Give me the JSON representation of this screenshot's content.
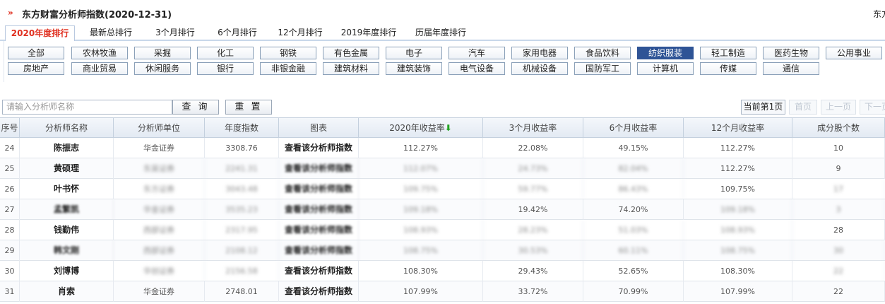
{
  "header": {
    "arrow": "»",
    "title": "东方财富分析师指数(2020-12-31)",
    "right_text": "东方"
  },
  "tabs": [
    {
      "label": "2020年度排行",
      "active": true
    },
    {
      "label": "最新总排行"
    },
    {
      "label": "3个月排行"
    },
    {
      "label": "6个月排行"
    },
    {
      "label": "12个月排行"
    },
    {
      "label": "2019年度排行"
    },
    {
      "label": "历届年度排行"
    }
  ],
  "categories_row1": [
    "全部",
    "农林牧渔",
    "采掘",
    "化工",
    "钢铁",
    "有色金属",
    "电子",
    "汽车",
    "家用电器",
    "食品饮料",
    "纺织服装",
    "轻工制造",
    "医药生物",
    "公用事业"
  ],
  "categories_row2": [
    "房地产",
    "商业贸易",
    "休闲服务",
    "银行",
    "非银金融",
    "建筑材料",
    "建筑装饰",
    "电气设备",
    "机械设备",
    "国防军工",
    "计算机",
    "传媒",
    "通信"
  ],
  "active_category": "纺织服装",
  "search": {
    "placeholder": "请输入分析师名称",
    "query_label": "查 询",
    "reset_label": "重 置"
  },
  "pager": {
    "current": "当前第1页",
    "first": "首页",
    "prev": "上一页",
    "next": "下一页"
  },
  "table": {
    "headers": [
      "序号",
      "分析师名称",
      "分析师单位",
      "年度指数",
      "图表",
      "2020年收益率",
      "3个月收益率",
      "6个月收益率",
      "12个月收益率",
      "成分股个数"
    ],
    "sort_indicator": "⬇",
    "rows": [
      [
        "24",
        "陈振志",
        "华金证券",
        "3308.76",
        "查看该分析师指数",
        "112.27%",
        "22.08%",
        "49.15%",
        "112.27%",
        "10"
      ],
      [
        "25",
        "黄硕理",
        "东吴证券",
        "2241.31",
        "查看该分析师指数",
        "112.07%",
        "24.73%",
        "82.04%",
        "112.27%",
        "9"
      ],
      [
        "26",
        "叶书怀",
        "东方证券",
        "3043.48",
        "查看该分析师指数",
        "109.75%",
        "59.77%",
        "86.43%",
        "109.75%",
        "17"
      ],
      [
        "27",
        "孟繁凯",
        "华金证券",
        "3535.23",
        "查看该分析师指数",
        "109.18%",
        "19.42%",
        "74.20%",
        "109.18%",
        "3"
      ],
      [
        "28",
        "钱勤伟",
        "西部证券",
        "2317.95",
        "查看该分析师指数",
        "108.93%",
        "28.23%",
        "51.03%",
        "108.93%",
        "28"
      ],
      [
        "29",
        "韩文刚",
        "西部证券",
        "2108.12",
        "查看该分析师指数",
        "108.75%",
        "30.53%",
        "60.11%",
        "108.75%",
        "30"
      ],
      [
        "30",
        "刘博博",
        "华创证券",
        "2156.58",
        "查看该分析师指数",
        "108.30%",
        "29.43%",
        "52.65%",
        "108.30%",
        "22"
      ],
      [
        "31",
        "肖索",
        "华金证券",
        "2748.01",
        "查看该分析师指数",
        "107.99%",
        "33.72%",
        "70.99%",
        "107.99%",
        "22"
      ]
    ]
  }
}
